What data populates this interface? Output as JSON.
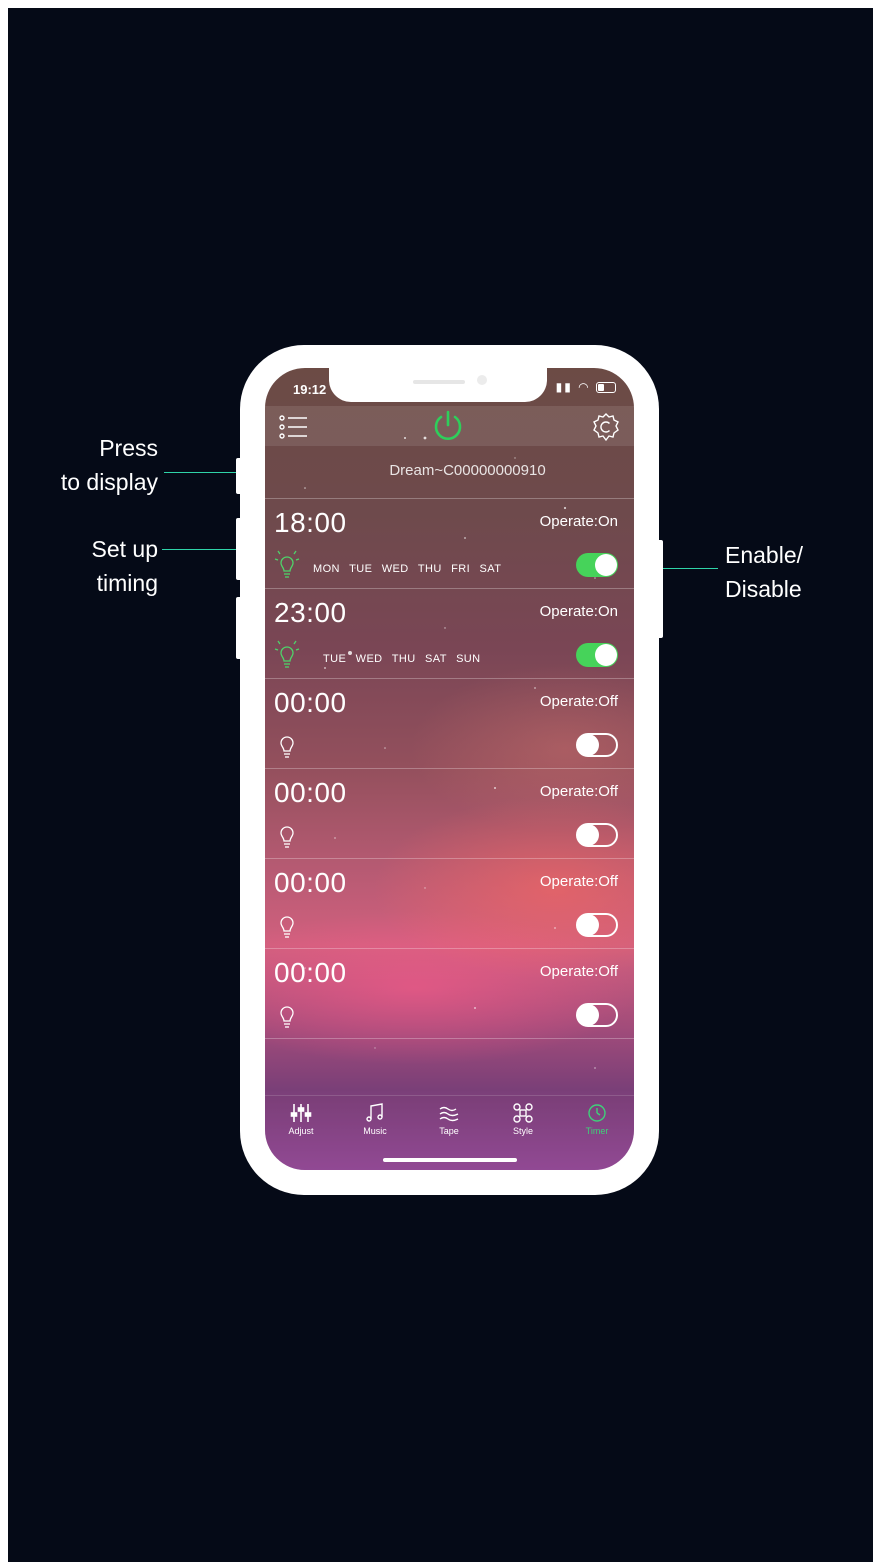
{
  "annotations": {
    "press_line1": "Press",
    "press_line2": "to display",
    "setup_line1": "Set up",
    "setup_line2": "timing",
    "enable_line1": "Enable/",
    "enable_line2": "Disable"
  },
  "status_bar": {
    "time": "19:12"
  },
  "toolbar": {
    "menu_icon": "menu-list-icon",
    "power_icon": "power-icon",
    "settings_icon": "gear-icon"
  },
  "device": {
    "name": "Dream~C00000000910"
  },
  "timers": [
    {
      "time": "18:00",
      "operate": "Operate:On",
      "days": "MON TUE WED THU FRI SAT",
      "enabled": true
    },
    {
      "time": "23:00",
      "operate": "Operate:On",
      "days": "TUE WED THU SAT SUN",
      "enabled": true
    },
    {
      "time": "00:00",
      "operate": "Operate:Off",
      "days": "",
      "enabled": false
    },
    {
      "time": "00:00",
      "operate": "Operate:Off",
      "days": "",
      "enabled": false
    },
    {
      "time": "00:00",
      "operate": "Operate:Off",
      "days": "",
      "enabled": false
    },
    {
      "time": "00:00",
      "operate": "Operate:Off",
      "days": "",
      "enabled": false
    }
  ],
  "tabs": [
    {
      "label": "Adjust",
      "icon": "sliders-icon"
    },
    {
      "label": "Music",
      "icon": "music-note-icon"
    },
    {
      "label": "Tape",
      "icon": "waves-icon"
    },
    {
      "label": "Style",
      "icon": "command-icon"
    },
    {
      "label": "Timer",
      "icon": "clock-icon",
      "active": true
    }
  ],
  "colors": {
    "accent": "#2fd3a8",
    "toggle_on": "#46d35a",
    "active_tab": "#3fd07a",
    "background": "#050a17"
  }
}
